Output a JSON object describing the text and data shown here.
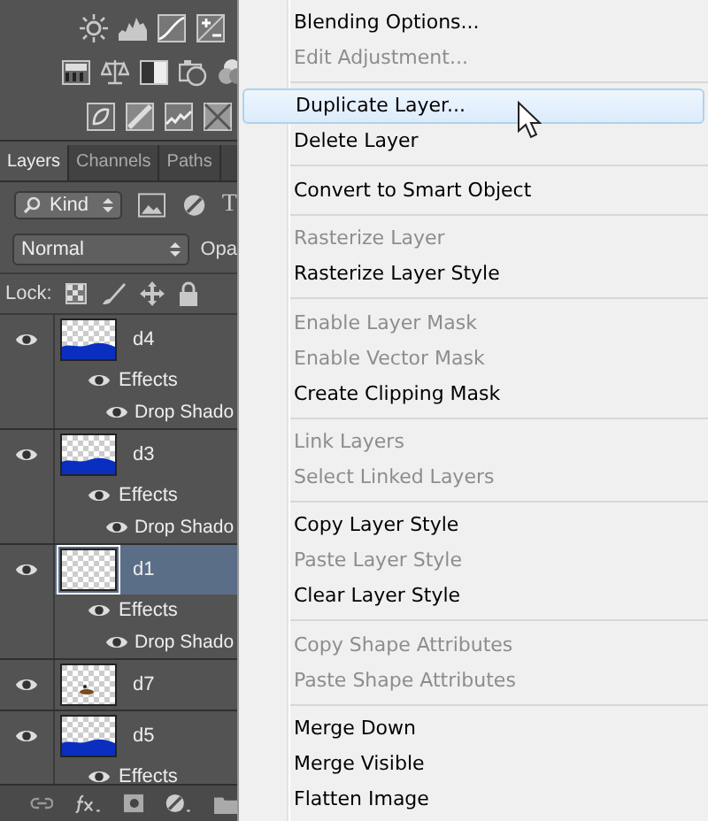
{
  "layers_panel": {
    "tabs": [
      {
        "label": "Layers",
        "selected": true
      },
      {
        "label": "Channels",
        "selected": false
      },
      {
        "label": "Paths",
        "selected": false
      }
    ],
    "filter": {
      "value": "Kind",
      "type_filter": "T"
    },
    "blend_mode": {
      "value": "Normal",
      "opacity_label": "Opa"
    },
    "lock_label": "Lock:",
    "layers": [
      {
        "name": "d4",
        "visible": true,
        "selected": false,
        "kind": "wave",
        "effects": {
          "label": "Effects",
          "visible": true,
          "items": [
            {
              "name": "Drop Shado",
              "visible": true
            }
          ]
        }
      },
      {
        "name": "d3",
        "visible": true,
        "selected": false,
        "kind": "wave",
        "effects": {
          "label": "Effects",
          "visible": true,
          "items": [
            {
              "name": "Drop Shado",
              "visible": true
            }
          ]
        }
      },
      {
        "name": "d1",
        "visible": true,
        "selected": true,
        "kind": "empty",
        "effects": {
          "label": "Effects",
          "visible": true,
          "items": [
            {
              "name": "Drop Shado",
              "visible": true
            }
          ]
        }
      },
      {
        "name": "d7",
        "visible": true,
        "selected": false,
        "kind": "spot"
      },
      {
        "name": "d5",
        "visible": true,
        "selected": false,
        "kind": "wave",
        "effects": {
          "label": "Effects",
          "visible": true
        }
      }
    ]
  },
  "context_menu": {
    "groups": [
      [
        {
          "label": "Blending Options...",
          "disabled": false,
          "highlighted": false
        },
        {
          "label": "Edit Adjustment...",
          "disabled": true,
          "highlighted": false
        }
      ],
      [
        {
          "label": "Duplicate Layer...",
          "disabled": false,
          "highlighted": true
        },
        {
          "label": "Delete Layer",
          "disabled": false,
          "highlighted": false
        }
      ],
      [
        {
          "label": "Convert to Smart Object",
          "disabled": false,
          "highlighted": false
        }
      ],
      [
        {
          "label": "Rasterize Layer",
          "disabled": true,
          "highlighted": false
        },
        {
          "label": "Rasterize Layer Style",
          "disabled": false,
          "highlighted": false
        }
      ],
      [
        {
          "label": "Enable Layer Mask",
          "disabled": true,
          "highlighted": false
        },
        {
          "label": "Enable Vector Mask",
          "disabled": true,
          "highlighted": false
        },
        {
          "label": "Create Clipping Mask",
          "disabled": false,
          "highlighted": false
        }
      ],
      [
        {
          "label": "Link Layers",
          "disabled": true,
          "highlighted": false
        },
        {
          "label": "Select Linked Layers",
          "disabled": true,
          "highlighted": false
        }
      ],
      [
        {
          "label": "Copy Layer Style",
          "disabled": false,
          "highlighted": false
        },
        {
          "label": "Paste Layer Style",
          "disabled": true,
          "highlighted": false
        },
        {
          "label": "Clear Layer Style",
          "disabled": false,
          "highlighted": false
        }
      ],
      [
        {
          "label": "Copy Shape Attributes",
          "disabled": true,
          "highlighted": false
        },
        {
          "label": "Paste Shape Attributes",
          "disabled": true,
          "highlighted": false
        }
      ],
      [
        {
          "label": "Merge Down",
          "disabled": false,
          "highlighted": false
        },
        {
          "label": "Merge Visible",
          "disabled": false,
          "highlighted": false
        },
        {
          "label": "Flatten Image",
          "disabled": false,
          "highlighted": false
        }
      ]
    ]
  }
}
